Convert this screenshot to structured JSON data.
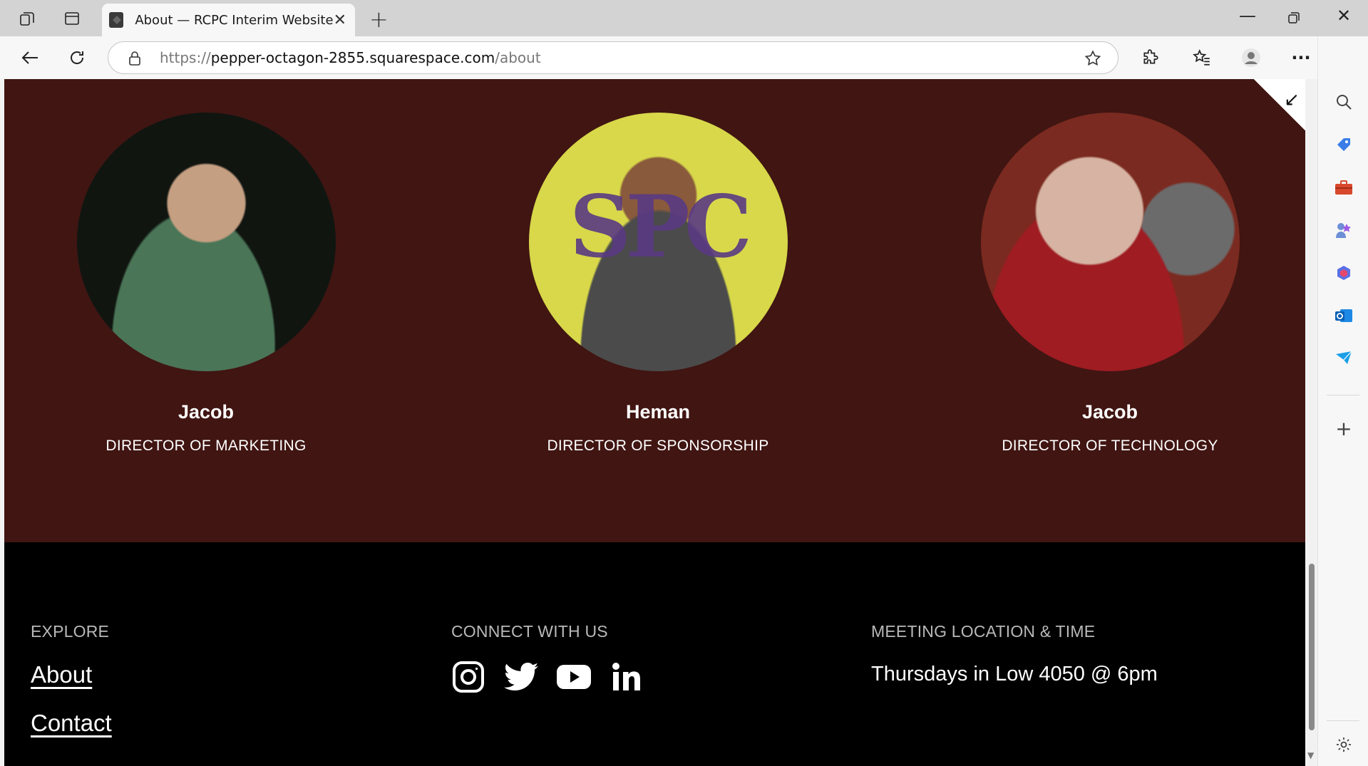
{
  "tab": {
    "title": "About — RCPC Interim Website"
  },
  "address": {
    "prefix": "https://",
    "host": "pepper-octagon-2855.squarespace.com",
    "path": "/about"
  },
  "team": [
    {
      "name": "Jacob",
      "role": "DIRECTOR OF MARKETING"
    },
    {
      "name": "Heman",
      "role": "DIRECTOR OF SPONSORSHIP",
      "photo_text": "SPC"
    },
    {
      "name": "Jacob",
      "role": "DIRECTOR OF TECHNOLOGY"
    }
  ],
  "footer": {
    "explore": {
      "heading": "EXPLORE",
      "links": [
        "About",
        "Contact"
      ]
    },
    "connect": {
      "heading": "CONNECT WITH US",
      "icons": [
        "instagram-icon",
        "twitter-icon",
        "youtube-icon",
        "linkedin-icon"
      ]
    },
    "meeting": {
      "heading": "MEETING LOCATION & TIME",
      "text": "Thursdays in Low 4050 @ 6pm"
    }
  },
  "colors": {
    "hero_bg": "#401512",
    "footer_bg": "#000000"
  }
}
